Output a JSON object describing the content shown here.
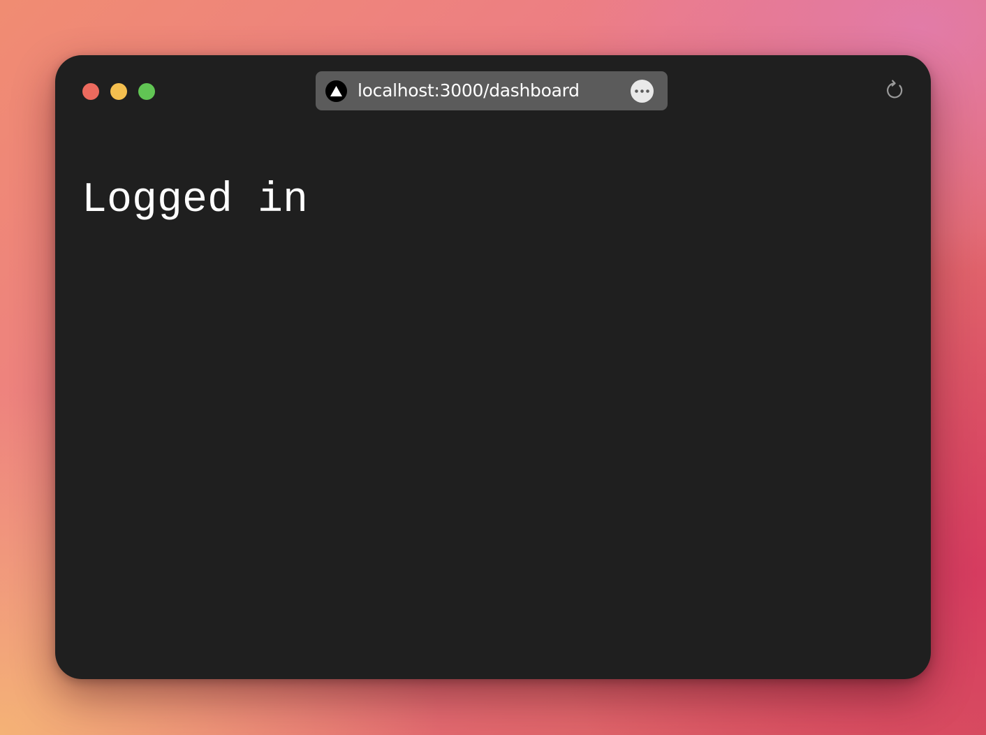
{
  "browser": {
    "url": "localhost:3000/dashboard",
    "site_icon": "triangle-logo-icon",
    "more_icon": "ellipsis-icon",
    "reload_icon": "reload-icon",
    "traffic_lights": {
      "close_color": "#ec6a5e",
      "minimize_color": "#f4bf4f",
      "zoom_color": "#61c554"
    }
  },
  "page": {
    "heading": "Logged in"
  },
  "colors": {
    "window_background": "#1f1f1f",
    "url_bar_background": "#5b5b5b",
    "text": "#ffffff"
  }
}
